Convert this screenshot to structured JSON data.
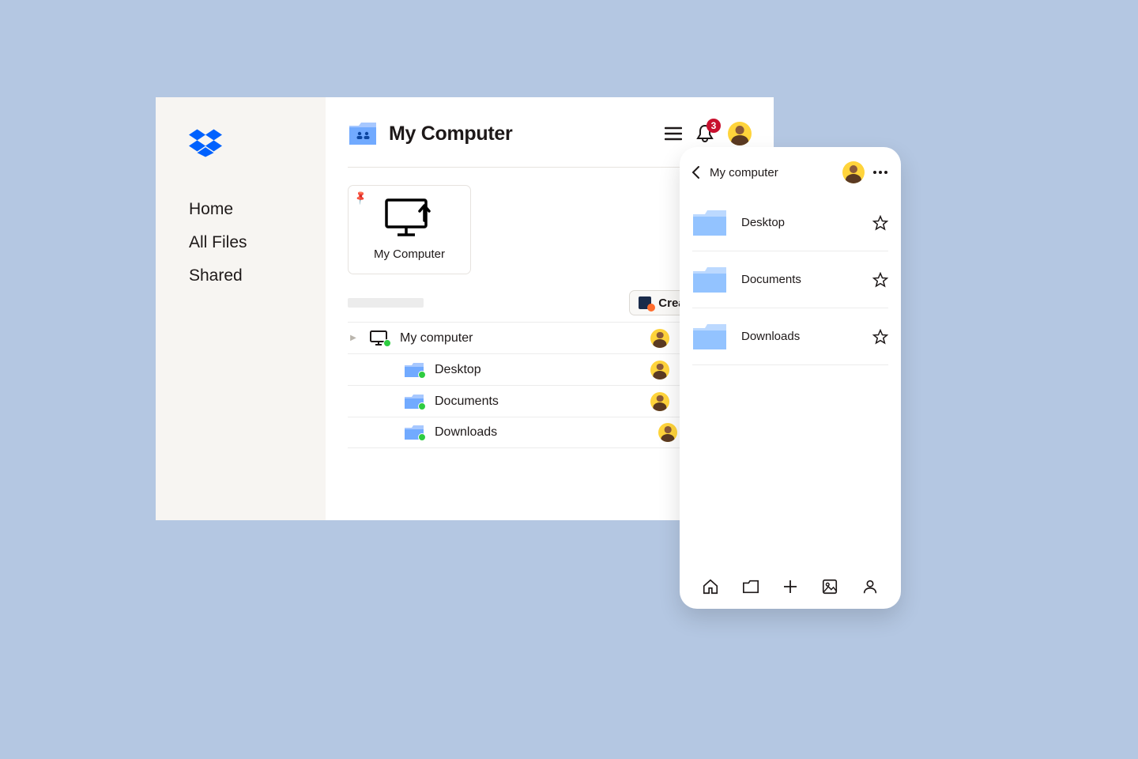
{
  "sidebar": {
    "items": [
      {
        "label": "Home"
      },
      {
        "label": "All Files"
      },
      {
        "label": "Shared"
      }
    ]
  },
  "header": {
    "title": "My Computer",
    "notification_count": "3"
  },
  "card": {
    "label": "My Computer"
  },
  "toolbar": {
    "create_label": "Create"
  },
  "rows": [
    {
      "name": "My computer",
      "indent": false,
      "icon": "monitor"
    },
    {
      "name": "Desktop",
      "indent": true,
      "icon": "folder"
    },
    {
      "name": "Documents",
      "indent": true,
      "icon": "folder"
    },
    {
      "name": "Downloads",
      "indent": true,
      "icon": "folder"
    }
  ],
  "mobile": {
    "title": "My computer",
    "items": [
      {
        "name": "Desktop"
      },
      {
        "name": "Documents"
      },
      {
        "name": "Downloads"
      }
    ]
  }
}
